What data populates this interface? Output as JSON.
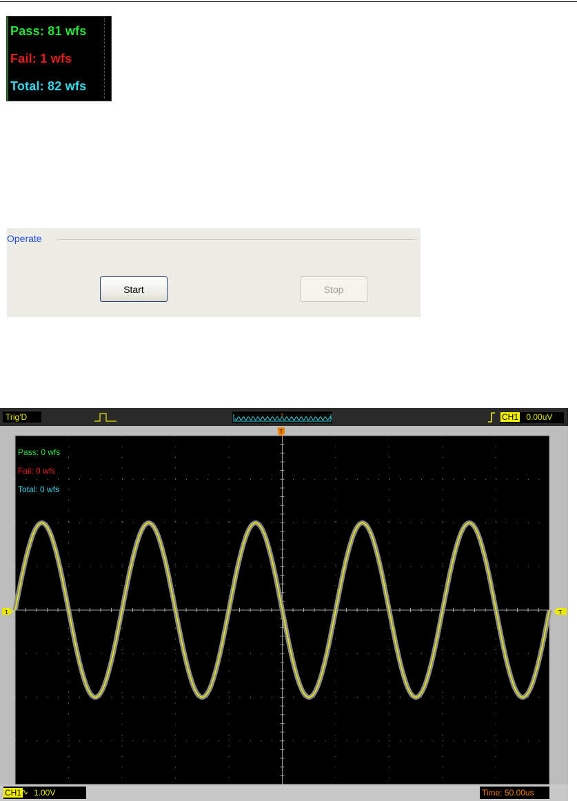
{
  "counter_box": {
    "pass": "Pass: 81 wfs",
    "fail": "Fail: 1 wfs",
    "total": "Total: 82 wfs",
    "colors": {
      "pass": "#23e23a",
      "fail": "#e81b1b",
      "total": "#35d6e8"
    }
  },
  "operate": {
    "group_label": "Operate",
    "start_label": "Start",
    "stop_label": "Stop"
  },
  "scope": {
    "trig_status": "Trig'D",
    "trigger_marker": "T",
    "ch1_marker": "1",
    "trigger_channel": "CH1",
    "trigger_level": "0.00uV",
    "overlay": {
      "pass": "Pass: 0 wfs",
      "fail": "Fail: 0 wfs",
      "total": "Total: 0 wfs"
    },
    "bottom": {
      "channel": "CH1",
      "coupling_icon": "ac-coupling-icon",
      "coupling_glyph": "∿",
      "volts_div": "1.00V",
      "timebase": "Time: 50.00us"
    },
    "waveform": {
      "type": "sine",
      "cycles_on_screen": 5,
      "amplitude_divs": 2,
      "color": "#e8e800"
    },
    "colors": {
      "screen_bg": "#000000",
      "grid": "#8a8a8a",
      "trace": "#e8e800",
      "trace_shadow": "#8c8c8c",
      "marker": "#e8e800",
      "trigger_marker": "#f08000"
    }
  }
}
